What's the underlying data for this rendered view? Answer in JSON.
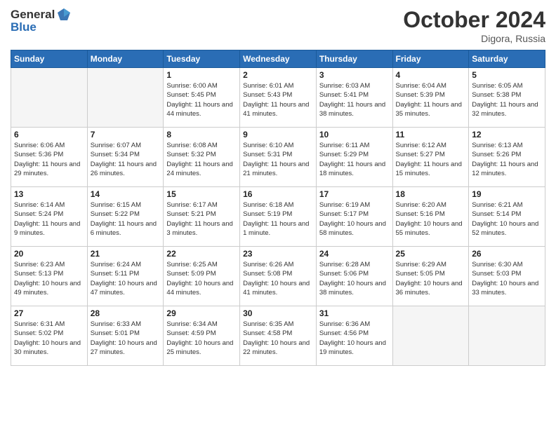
{
  "header": {
    "logo_general": "General",
    "logo_blue": "Blue",
    "title": "October 2024",
    "location": "Digora, Russia"
  },
  "days_of_week": [
    "Sunday",
    "Monday",
    "Tuesday",
    "Wednesday",
    "Thursday",
    "Friday",
    "Saturday"
  ],
  "weeks": [
    [
      {
        "day": "",
        "info": "",
        "empty": true
      },
      {
        "day": "",
        "info": "",
        "empty": true
      },
      {
        "day": "1",
        "info": "Sunrise: 6:00 AM\nSunset: 5:45 PM\nDaylight: 11 hours and 44 minutes."
      },
      {
        "day": "2",
        "info": "Sunrise: 6:01 AM\nSunset: 5:43 PM\nDaylight: 11 hours and 41 minutes."
      },
      {
        "day": "3",
        "info": "Sunrise: 6:03 AM\nSunset: 5:41 PM\nDaylight: 11 hours and 38 minutes."
      },
      {
        "day": "4",
        "info": "Sunrise: 6:04 AM\nSunset: 5:39 PM\nDaylight: 11 hours and 35 minutes."
      },
      {
        "day": "5",
        "info": "Sunrise: 6:05 AM\nSunset: 5:38 PM\nDaylight: 11 hours and 32 minutes."
      }
    ],
    [
      {
        "day": "6",
        "info": "Sunrise: 6:06 AM\nSunset: 5:36 PM\nDaylight: 11 hours and 29 minutes."
      },
      {
        "day": "7",
        "info": "Sunrise: 6:07 AM\nSunset: 5:34 PM\nDaylight: 11 hours and 26 minutes."
      },
      {
        "day": "8",
        "info": "Sunrise: 6:08 AM\nSunset: 5:32 PM\nDaylight: 11 hours and 24 minutes."
      },
      {
        "day": "9",
        "info": "Sunrise: 6:10 AM\nSunset: 5:31 PM\nDaylight: 11 hours and 21 minutes."
      },
      {
        "day": "10",
        "info": "Sunrise: 6:11 AM\nSunset: 5:29 PM\nDaylight: 11 hours and 18 minutes."
      },
      {
        "day": "11",
        "info": "Sunrise: 6:12 AM\nSunset: 5:27 PM\nDaylight: 11 hours and 15 minutes."
      },
      {
        "day": "12",
        "info": "Sunrise: 6:13 AM\nSunset: 5:26 PM\nDaylight: 11 hours and 12 minutes."
      }
    ],
    [
      {
        "day": "13",
        "info": "Sunrise: 6:14 AM\nSunset: 5:24 PM\nDaylight: 11 hours and 9 minutes."
      },
      {
        "day": "14",
        "info": "Sunrise: 6:15 AM\nSunset: 5:22 PM\nDaylight: 11 hours and 6 minutes."
      },
      {
        "day": "15",
        "info": "Sunrise: 6:17 AM\nSunset: 5:21 PM\nDaylight: 11 hours and 3 minutes."
      },
      {
        "day": "16",
        "info": "Sunrise: 6:18 AM\nSunset: 5:19 PM\nDaylight: 11 hours and 1 minute."
      },
      {
        "day": "17",
        "info": "Sunrise: 6:19 AM\nSunset: 5:17 PM\nDaylight: 10 hours and 58 minutes."
      },
      {
        "day": "18",
        "info": "Sunrise: 6:20 AM\nSunset: 5:16 PM\nDaylight: 10 hours and 55 minutes."
      },
      {
        "day": "19",
        "info": "Sunrise: 6:21 AM\nSunset: 5:14 PM\nDaylight: 10 hours and 52 minutes."
      }
    ],
    [
      {
        "day": "20",
        "info": "Sunrise: 6:23 AM\nSunset: 5:13 PM\nDaylight: 10 hours and 49 minutes."
      },
      {
        "day": "21",
        "info": "Sunrise: 6:24 AM\nSunset: 5:11 PM\nDaylight: 10 hours and 47 minutes."
      },
      {
        "day": "22",
        "info": "Sunrise: 6:25 AM\nSunset: 5:09 PM\nDaylight: 10 hours and 44 minutes."
      },
      {
        "day": "23",
        "info": "Sunrise: 6:26 AM\nSunset: 5:08 PM\nDaylight: 10 hours and 41 minutes."
      },
      {
        "day": "24",
        "info": "Sunrise: 6:28 AM\nSunset: 5:06 PM\nDaylight: 10 hours and 38 minutes."
      },
      {
        "day": "25",
        "info": "Sunrise: 6:29 AM\nSunset: 5:05 PM\nDaylight: 10 hours and 36 minutes."
      },
      {
        "day": "26",
        "info": "Sunrise: 6:30 AM\nSunset: 5:03 PM\nDaylight: 10 hours and 33 minutes."
      }
    ],
    [
      {
        "day": "27",
        "info": "Sunrise: 6:31 AM\nSunset: 5:02 PM\nDaylight: 10 hours and 30 minutes."
      },
      {
        "day": "28",
        "info": "Sunrise: 6:33 AM\nSunset: 5:01 PM\nDaylight: 10 hours and 27 minutes."
      },
      {
        "day": "29",
        "info": "Sunrise: 6:34 AM\nSunset: 4:59 PM\nDaylight: 10 hours and 25 minutes."
      },
      {
        "day": "30",
        "info": "Sunrise: 6:35 AM\nSunset: 4:58 PM\nDaylight: 10 hours and 22 minutes."
      },
      {
        "day": "31",
        "info": "Sunrise: 6:36 AM\nSunset: 4:56 PM\nDaylight: 10 hours and 19 minutes."
      },
      {
        "day": "",
        "info": "",
        "empty": true
      },
      {
        "day": "",
        "info": "",
        "empty": true
      }
    ]
  ]
}
